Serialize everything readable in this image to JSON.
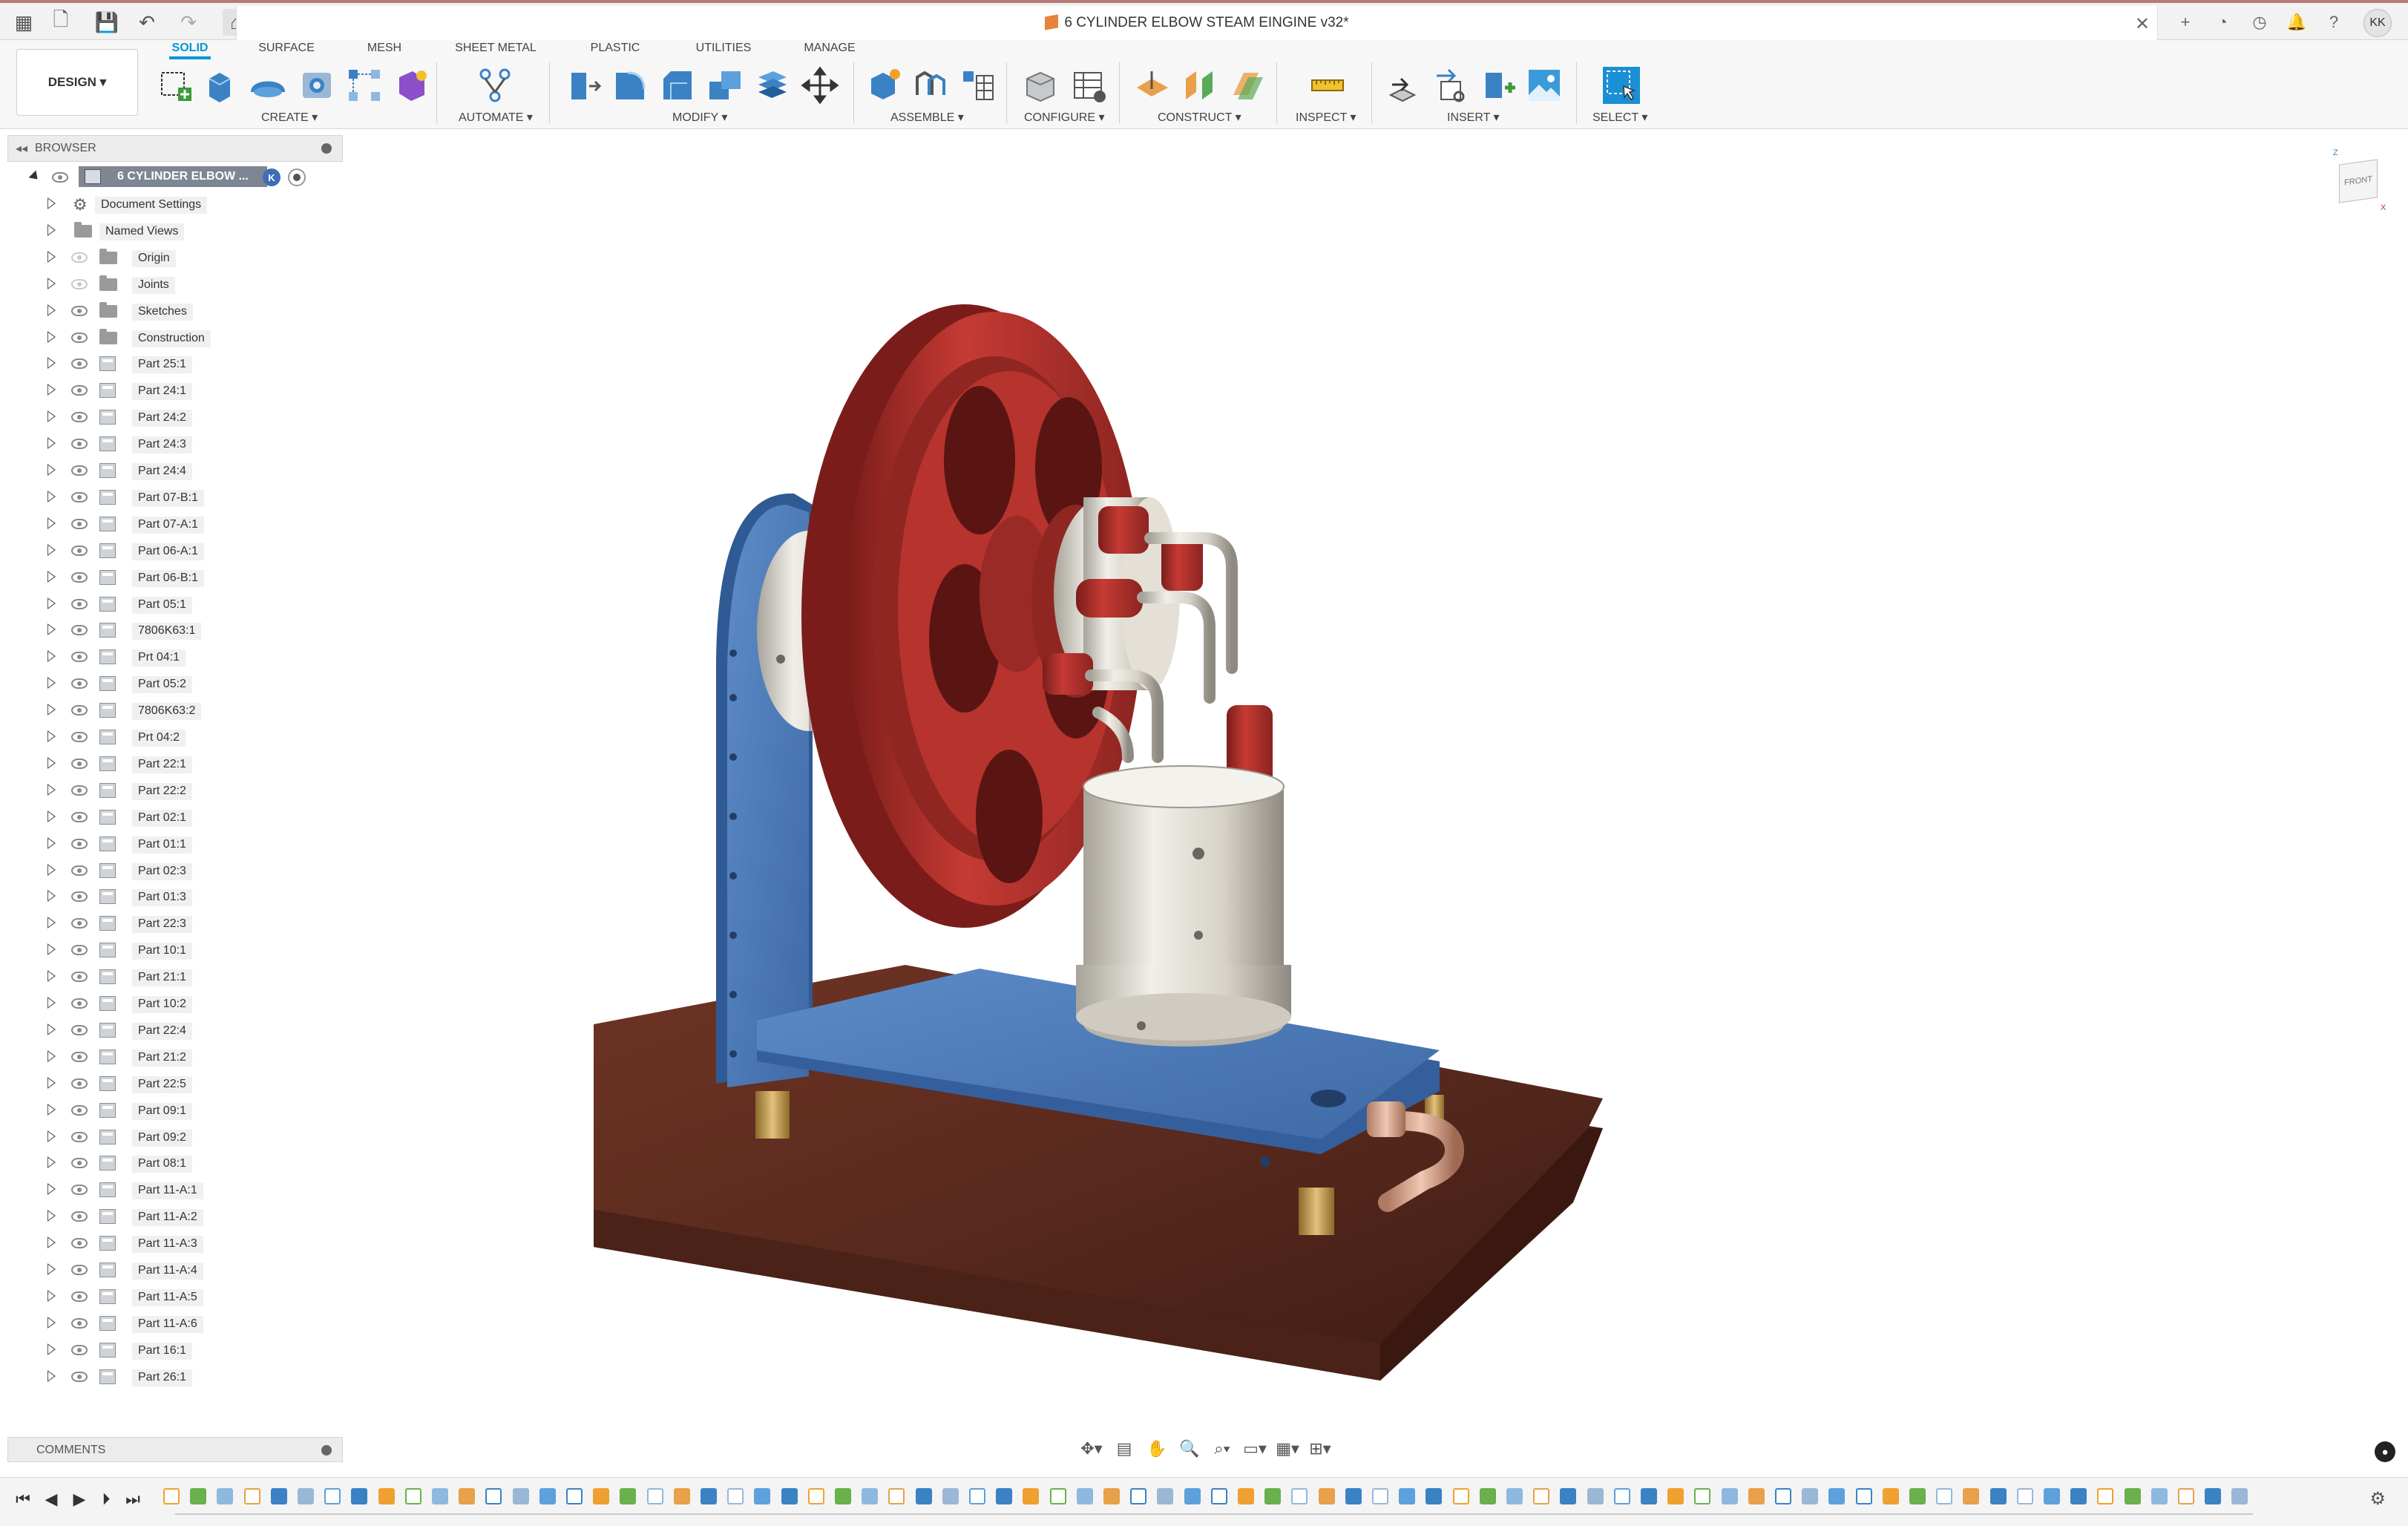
{
  "document": {
    "title": "6 CYLINDER ELBOW STEAM EINGINE v32*"
  },
  "user": {
    "initials": "KK"
  },
  "workspace": {
    "label": "DESIGN ▾"
  },
  "ribbon": {
    "tabs": [
      {
        "label": "SOLID",
        "active": true
      },
      {
        "label": "SURFACE"
      },
      {
        "label": "MESH"
      },
      {
        "label": "SHEET METAL"
      },
      {
        "label": "PLASTIC"
      },
      {
        "label": "UTILITIES"
      },
      {
        "label": "MANAGE"
      }
    ],
    "groups": [
      {
        "label": "CREATE ▾"
      },
      {
        "label": "AUTOMATE ▾"
      },
      {
        "label": "MODIFY ▾"
      },
      {
        "label": "ASSEMBLE ▾"
      },
      {
        "label": "CONFIGURE ▾"
      },
      {
        "label": "CONSTRUCT ▾"
      },
      {
        "label": "INSPECT ▾"
      },
      {
        "label": "INSERT ▾"
      },
      {
        "label": "SELECT ▾"
      }
    ]
  },
  "browser": {
    "title": "BROWSER",
    "root": "6 CYLINDER ELBOW ...",
    "root_badge": "K",
    "items": [
      {
        "label": "Document Settings",
        "kind": "settings"
      },
      {
        "label": "Named Views",
        "kind": "folder"
      },
      {
        "label": "Origin",
        "kind": "folder",
        "hidden": true
      },
      {
        "label": "Joints",
        "kind": "folder",
        "hidden": true
      },
      {
        "label": "Sketches",
        "kind": "folder"
      },
      {
        "label": "Construction",
        "kind": "folder"
      },
      {
        "label": "Part 25:1",
        "kind": "comp"
      },
      {
        "label": "Part 24:1",
        "kind": "comp"
      },
      {
        "label": "Part 24:2",
        "kind": "comp"
      },
      {
        "label": "Part 24:3",
        "kind": "comp"
      },
      {
        "label": "Part 24:4",
        "kind": "comp"
      },
      {
        "label": "Part 07-B:1",
        "kind": "comp"
      },
      {
        "label": "Part 07-A:1",
        "kind": "comp"
      },
      {
        "label": "Part 06-A:1",
        "kind": "comp"
      },
      {
        "label": "Part 06-B:1",
        "kind": "comp"
      },
      {
        "label": "Part 05:1",
        "kind": "comp"
      },
      {
        "label": "7806K63:1",
        "kind": "comp"
      },
      {
        "label": "Prt 04:1",
        "kind": "comp"
      },
      {
        "label": "Part 05:2",
        "kind": "comp"
      },
      {
        "label": "7806K63:2",
        "kind": "comp"
      },
      {
        "label": "Prt 04:2",
        "kind": "comp"
      },
      {
        "label": "Part 22:1",
        "kind": "comp"
      },
      {
        "label": "Part 22:2",
        "kind": "comp"
      },
      {
        "label": "Part 02:1",
        "kind": "comp"
      },
      {
        "label": "Part 01:1",
        "kind": "comp"
      },
      {
        "label": "Part 02:3",
        "kind": "comp"
      },
      {
        "label": "Part 01:3",
        "kind": "comp"
      },
      {
        "label": "Part 22:3",
        "kind": "comp"
      },
      {
        "label": "Part 10:1",
        "kind": "comp"
      },
      {
        "label": "Part 21:1",
        "kind": "comp"
      },
      {
        "label": "Part 10:2",
        "kind": "comp"
      },
      {
        "label": "Part 22:4",
        "kind": "comp"
      },
      {
        "label": "Part 21:2",
        "kind": "comp"
      },
      {
        "label": "Part 22:5",
        "kind": "comp"
      },
      {
        "label": "Part 09:1",
        "kind": "comp"
      },
      {
        "label": "Part 09:2",
        "kind": "comp"
      },
      {
        "label": "Part 08:1",
        "kind": "comp"
      },
      {
        "label": "Part 11-A:1",
        "kind": "comp"
      },
      {
        "label": "Part 11-A:2",
        "kind": "comp"
      },
      {
        "label": "Part 11-A:3",
        "kind": "comp"
      },
      {
        "label": "Part 11-A:4",
        "kind": "comp"
      },
      {
        "label": "Part 11-A:5",
        "kind": "comp"
      },
      {
        "label": "Part 11-A:6",
        "kind": "comp"
      },
      {
        "label": "Part 16:1",
        "kind": "comp"
      },
      {
        "label": "Part 26:1",
        "kind": "comp"
      }
    ]
  },
  "comments": {
    "title": "COMMENTS"
  },
  "viewcube": {
    "face": "FRONT",
    "axis_z": "Z",
    "axis_x": "X"
  },
  "colors": {
    "accent": "#0696d7",
    "flywheel": "#b8322e",
    "frame": "#4a78b8",
    "base": "#5a2a1e"
  }
}
